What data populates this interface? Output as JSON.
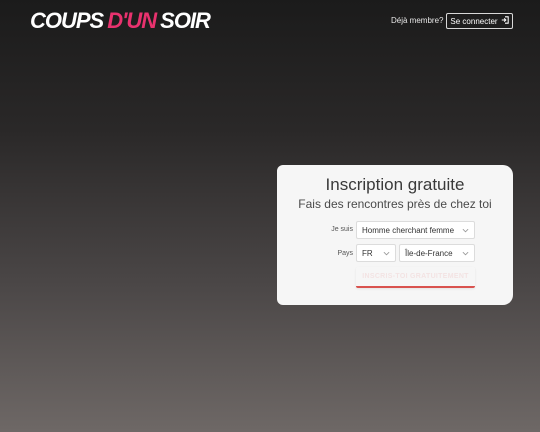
{
  "header": {
    "logo_part1": "COUPS",
    "logo_part2": "D'UN",
    "logo_part3": "SOIR",
    "already_member": "Déjà membre?",
    "login_label": "Se connecter"
  },
  "signup": {
    "title": "Inscription gratuite",
    "subtitle": "Fais des rencontres près de chez toi",
    "iam_label": "Je suis",
    "iam_value": "Homme cherchant femme",
    "country_label": "Pays",
    "country_value": "FR",
    "region_value": "Île-de-France",
    "submit_label": "INSCRIS-TOI GRATUITEMENT"
  },
  "colors": {
    "brand_pink": "#e8326e",
    "accent_red": "#d9534f"
  },
  "icons": {
    "login": "sign-in-icon",
    "dropdown": "chevron-down-icon"
  }
}
